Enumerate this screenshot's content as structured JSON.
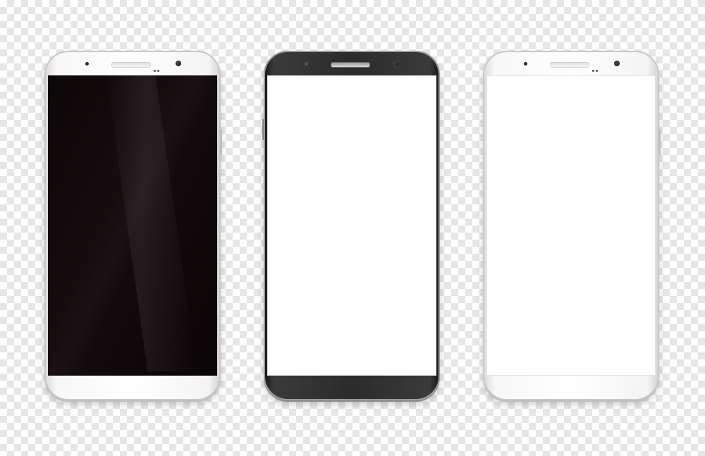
{
  "scene": {
    "background": "transparency-checkerboard"
  },
  "phones": [
    {
      "bezel_color": "#ffffff",
      "screen_color": "#0f0809"
    },
    {
      "bezel_color": "#2b2b2b",
      "screen_color": "#ffffff"
    },
    {
      "bezel_color": "#ffffff",
      "screen_color": "#ffffff"
    }
  ],
  "icons": {
    "speaker": "earpiece-speaker-icon",
    "camera": "front-camera-icon",
    "sensor": "proximity-sensor-icon"
  }
}
